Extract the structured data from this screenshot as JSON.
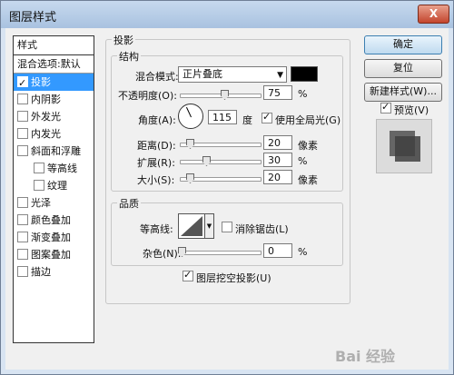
{
  "window": {
    "title": "图层样式",
    "close_glyph": "X"
  },
  "styles": {
    "header": "样式",
    "blend_label": "混合选项:默认",
    "items": [
      {
        "label": "投影",
        "checked": true,
        "selected": true
      },
      {
        "label": "内阴影",
        "checked": false
      },
      {
        "label": "外发光",
        "checked": false
      },
      {
        "label": "内发光",
        "checked": false
      },
      {
        "label": "斜面和浮雕",
        "checked": false
      },
      {
        "label": "等高线",
        "checked": false
      },
      {
        "label": "纹理",
        "checked": false
      },
      {
        "label": "光泽",
        "checked": false
      },
      {
        "label": "颜色叠加",
        "checked": false
      },
      {
        "label": "渐变叠加",
        "checked": false
      },
      {
        "label": "图案叠加",
        "checked": false
      },
      {
        "label": "描边",
        "checked": false
      }
    ]
  },
  "shadow": {
    "title": "投影",
    "structure_title": "结构",
    "blend_mode_label": "混合模式:",
    "blend_mode_value": "正片叠底",
    "swatch_color": "#000000",
    "opacity_label": "不透明度(O):",
    "opacity_value": "75",
    "opacity_unit": "%",
    "angle_label": "角度(A):",
    "angle_value": "115",
    "angle_unit": "度",
    "global_light_label": "使用全局光(G)",
    "global_light_checked": true,
    "distance_label": "距离(D):",
    "distance_value": "20",
    "distance_unit": "像素",
    "spread_label": "扩展(R):",
    "spread_value": "30",
    "spread_unit": "%",
    "size_label": "大小(S):",
    "size_value": "20",
    "size_unit": "像素",
    "quality_title": "品质",
    "contour_label": "等高线:",
    "anti_alias_label": "消除锯齿(L)",
    "noise_label": "杂色(N):",
    "noise_value": "0",
    "noise_unit": "%",
    "knockout_label": "图层挖空投影(U)"
  },
  "buttons": {
    "ok": "确定",
    "reset": "复位",
    "new_style": "新建样式(W)...",
    "preview_label": "预览(V)"
  },
  "watermark": "Bai 经验"
}
